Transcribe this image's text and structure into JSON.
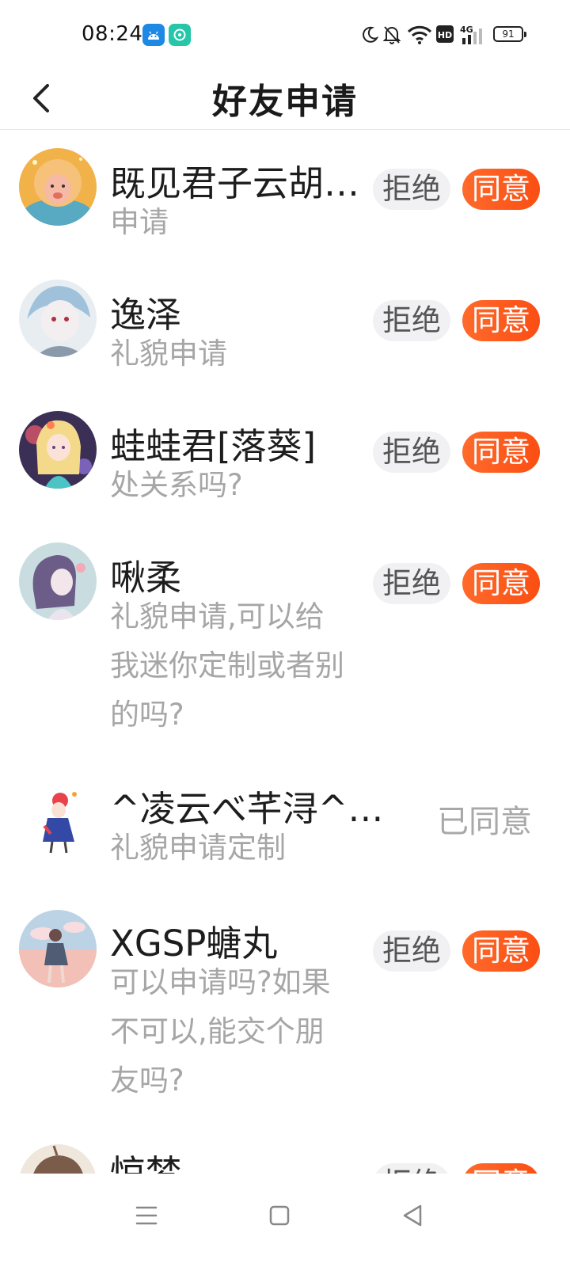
{
  "status_bar": {
    "time": "08:24",
    "battery": "91",
    "network": "4G"
  },
  "header": {
    "title": "好友申请"
  },
  "colors": {
    "accent_start": "#ff6a2b",
    "accent_end": "#fb4e13",
    "reject_bg": "#f1f1f3"
  },
  "requests": [
    {
      "name": "既见君子云胡…",
      "message": "申请",
      "reject_label": "拒绝",
      "accept_label": "同意"
    },
    {
      "name": "逸泽",
      "message": "礼貌申请",
      "reject_label": "拒绝",
      "accept_label": "同意"
    },
    {
      "name": "蛙蛙君[落葵]",
      "message": "处关系吗?",
      "reject_label": "拒绝",
      "accept_label": "同意"
    },
    {
      "name": "啾柔",
      "message": "礼貌申请,可以给我迷你定制或者别的吗?",
      "reject_label": "拒绝",
      "accept_label": "同意"
    },
    {
      "name": "^凌云べ芊浔^(…",
      "message": "礼貌申请定制",
      "status_label": "已同意"
    },
    {
      "name": "XGSP螗丸",
      "message": "可以申请吗?如果不可以,能交个朋友吗?",
      "reject_label": "拒绝",
      "accept_label": "同意"
    },
    {
      "name": "惊梦",
      "message": "",
      "reject_label": "拒绝",
      "accept_label": "同意"
    }
  ],
  "nav": {
    "icons": [
      "menu-icon",
      "home-square-icon",
      "back-triangle-icon"
    ]
  }
}
